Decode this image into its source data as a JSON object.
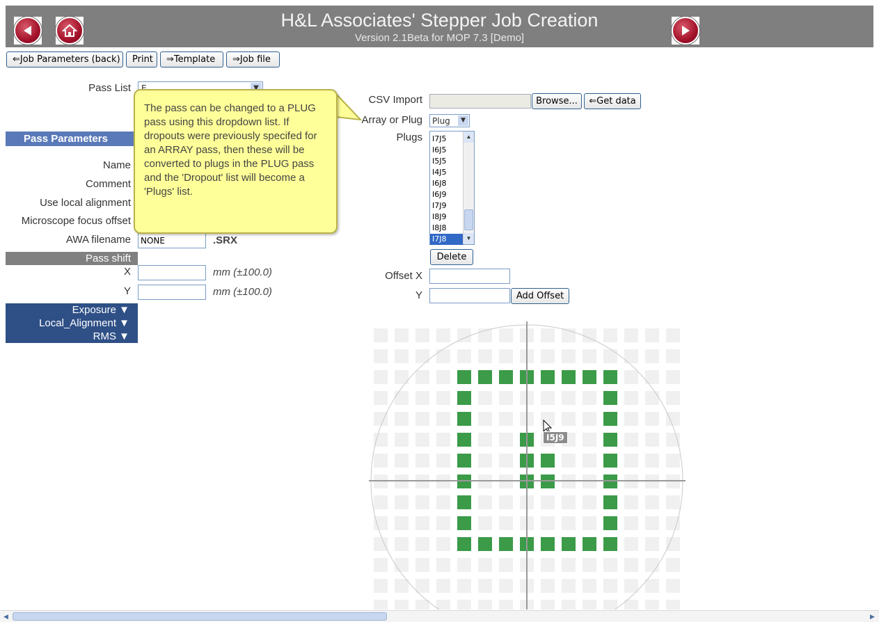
{
  "header": {
    "title": "H&L Associates' Stepper Job Creation",
    "subtitle": "Version 2.1Beta for MOP 7.3   [Demo]"
  },
  "toolbar": {
    "job_params_back": "⇐Job Parameters (back)",
    "print": "Print",
    "template": "⇒Template",
    "job_file": "⇒Job file"
  },
  "pass_list": {
    "label": "Pass List",
    "value": "E"
  },
  "pass_parameters": {
    "heading": "Pass Parameters",
    "name_label": "Name",
    "comment_label": "Comment",
    "use_local_alignment_label": "Use local alignment",
    "microscope_focus_offset_label": "Microscope focus offset",
    "awa_filename_label": "AWA filename",
    "awa_filename_value": "NONE",
    "awa_ext": ".SRX"
  },
  "pass_shift": {
    "heading": "Pass shift",
    "x_label": "X",
    "y_label": "Y",
    "unit": "mm (±100.0)"
  },
  "collapsibles": [
    "Exposure ▼",
    "Local_Alignment ▼",
    "RMS ▼"
  ],
  "tooltip": {
    "text": "The pass can be changed to a PLUG pass using this dropdown list. If dropouts were previously specifed for an ARRAY pass, then these will be converted to plugs in the PLUG pass and the 'Dropout' list will become a 'Plugs' list."
  },
  "right_panel": {
    "csv_import_label": "CSV Import",
    "browse_button": "Browse...",
    "get_data_button": "⇐Get data",
    "array_or_plug_label": "Array or Plug",
    "array_or_plug_value": "Plug",
    "plugs_label": "Plugs",
    "plugs": [
      "I7J5",
      "I6J5",
      "I5J5",
      "I4J5",
      "I6J8",
      "I6J9",
      "I7J9",
      "I8J9",
      "I8J8",
      "I7J8"
    ],
    "plugs_selected_index": 9,
    "delete_button": "Delete",
    "offset_x_label": "Offset X",
    "offset_y_label": "Y",
    "add_offset_button": "Add Offset"
  },
  "wafer_map": {
    "hover_label": "I5J9",
    "colors": {
      "on": "#3b9b48",
      "off": "#f0f0f0"
    }
  }
}
